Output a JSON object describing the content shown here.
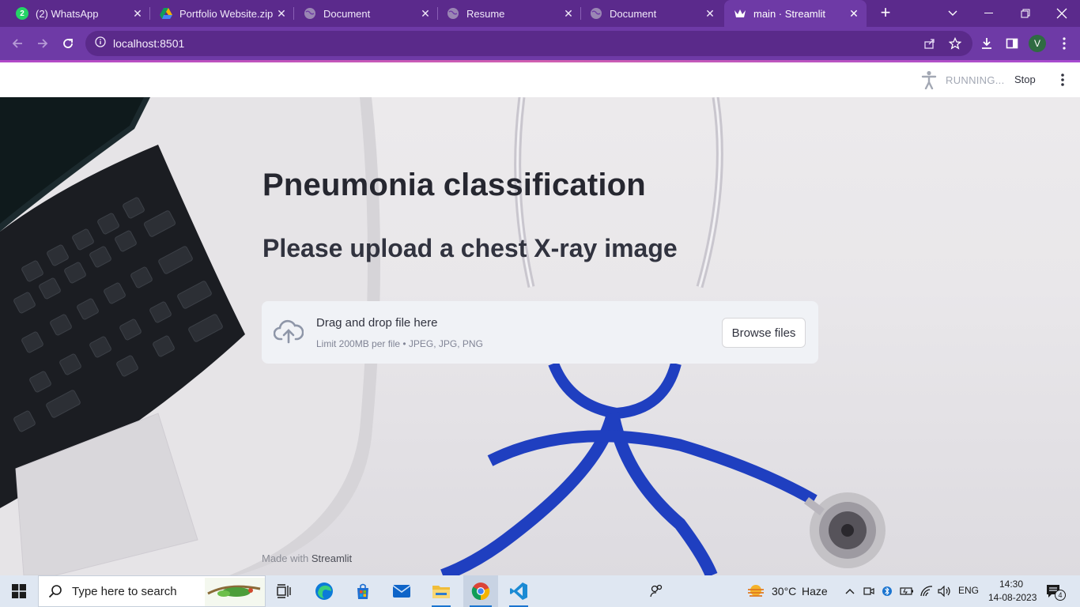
{
  "browser": {
    "tabs": [
      {
        "title": "(2) WhatsApp",
        "icon": "whatsapp-icon",
        "color": "#25d366",
        "badge": "2",
        "active": false
      },
      {
        "title": "Portfolio Website.zip -",
        "icon": "google-drive-icon",
        "color": "#f4b400",
        "active": false
      },
      {
        "title": "Document",
        "icon": "globe-icon",
        "color": "#9a86b4",
        "active": false
      },
      {
        "title": "Resume",
        "icon": "globe-icon",
        "color": "#9a86b4",
        "active": false
      },
      {
        "title": "Document",
        "icon": "globe-icon",
        "color": "#9a86b4",
        "active": false
      },
      {
        "title": "main · Streamlit",
        "icon": "streamlit-crown-icon",
        "color": "#ffffff",
        "active": true
      }
    ],
    "new_tab": "+",
    "url": "localhost:8501",
    "profile_initial": "V",
    "theme_color": "#6e3aa6"
  },
  "streamlit": {
    "status": "RUNNING...",
    "stop_label": "Stop",
    "title": "Pneumonia classification",
    "subtitle": "Please upload a chest X-ray image",
    "uploader": {
      "main_text": "Drag and drop file here",
      "limit_text": "Limit 200MB per file • JPEG, JPG, PNG",
      "button_label": "Browse files"
    },
    "footer": {
      "prefix": "Made with",
      "brand": "Streamlit"
    }
  },
  "taskbar": {
    "search_placeholder": "Type here to search",
    "weather": {
      "temp": "30°C",
      "condition": "Haze"
    },
    "language": "ENG",
    "time": "14:30",
    "date": "14-08-2023",
    "notification_count": "4"
  }
}
